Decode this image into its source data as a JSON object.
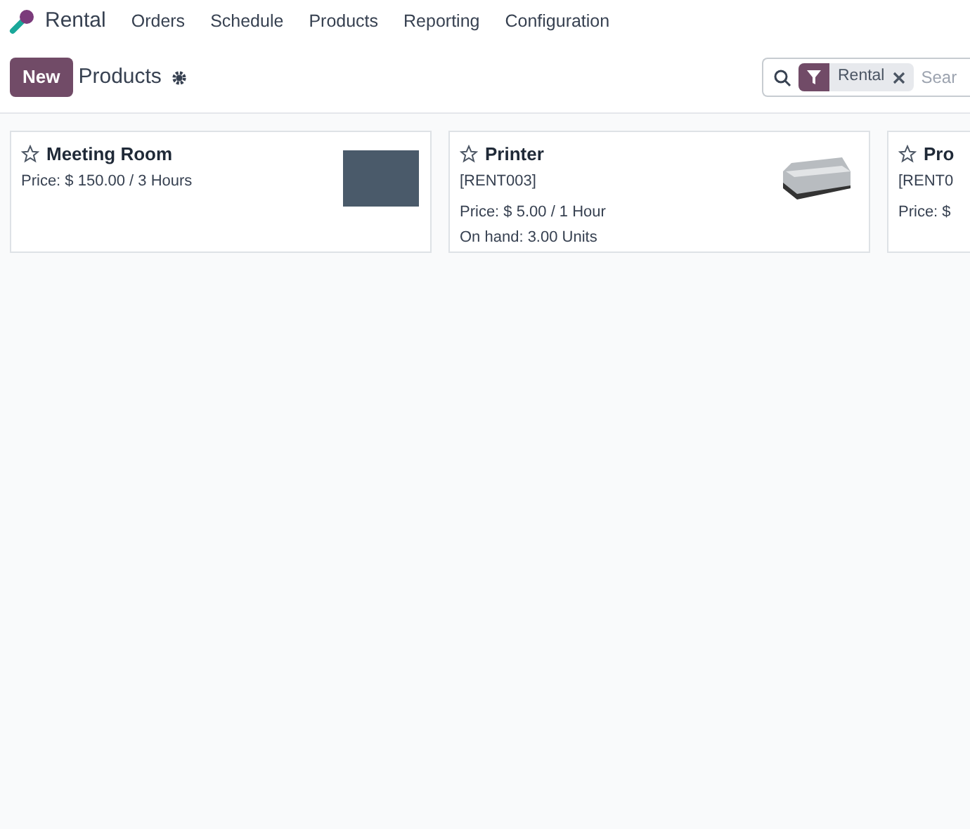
{
  "app": {
    "name": "Rental",
    "menu": [
      "Orders",
      "Schedule",
      "Products",
      "Reporting",
      "Configuration"
    ]
  },
  "control_panel": {
    "new_button": "New",
    "title": "Products",
    "search": {
      "facet": "Rental",
      "placeholder": "Sear"
    }
  },
  "cards": [
    {
      "kind": "photo",
      "name": "Meeting Room",
      "starred": false,
      "lines": [
        "Price: $ 150.00 / 3 Hours"
      ]
    },
    {
      "kind": "printer",
      "name": "Printer",
      "starred": false,
      "code": "[RENT003]",
      "lines": [
        "Price: $ 5.00 / 1 Hour",
        "On hand: 3.00 Units"
      ]
    },
    {
      "kind": "none",
      "name": "Pro",
      "starred": false,
      "code": "[RENT0",
      "lines": [
        "Price: $"
      ]
    }
  ]
}
